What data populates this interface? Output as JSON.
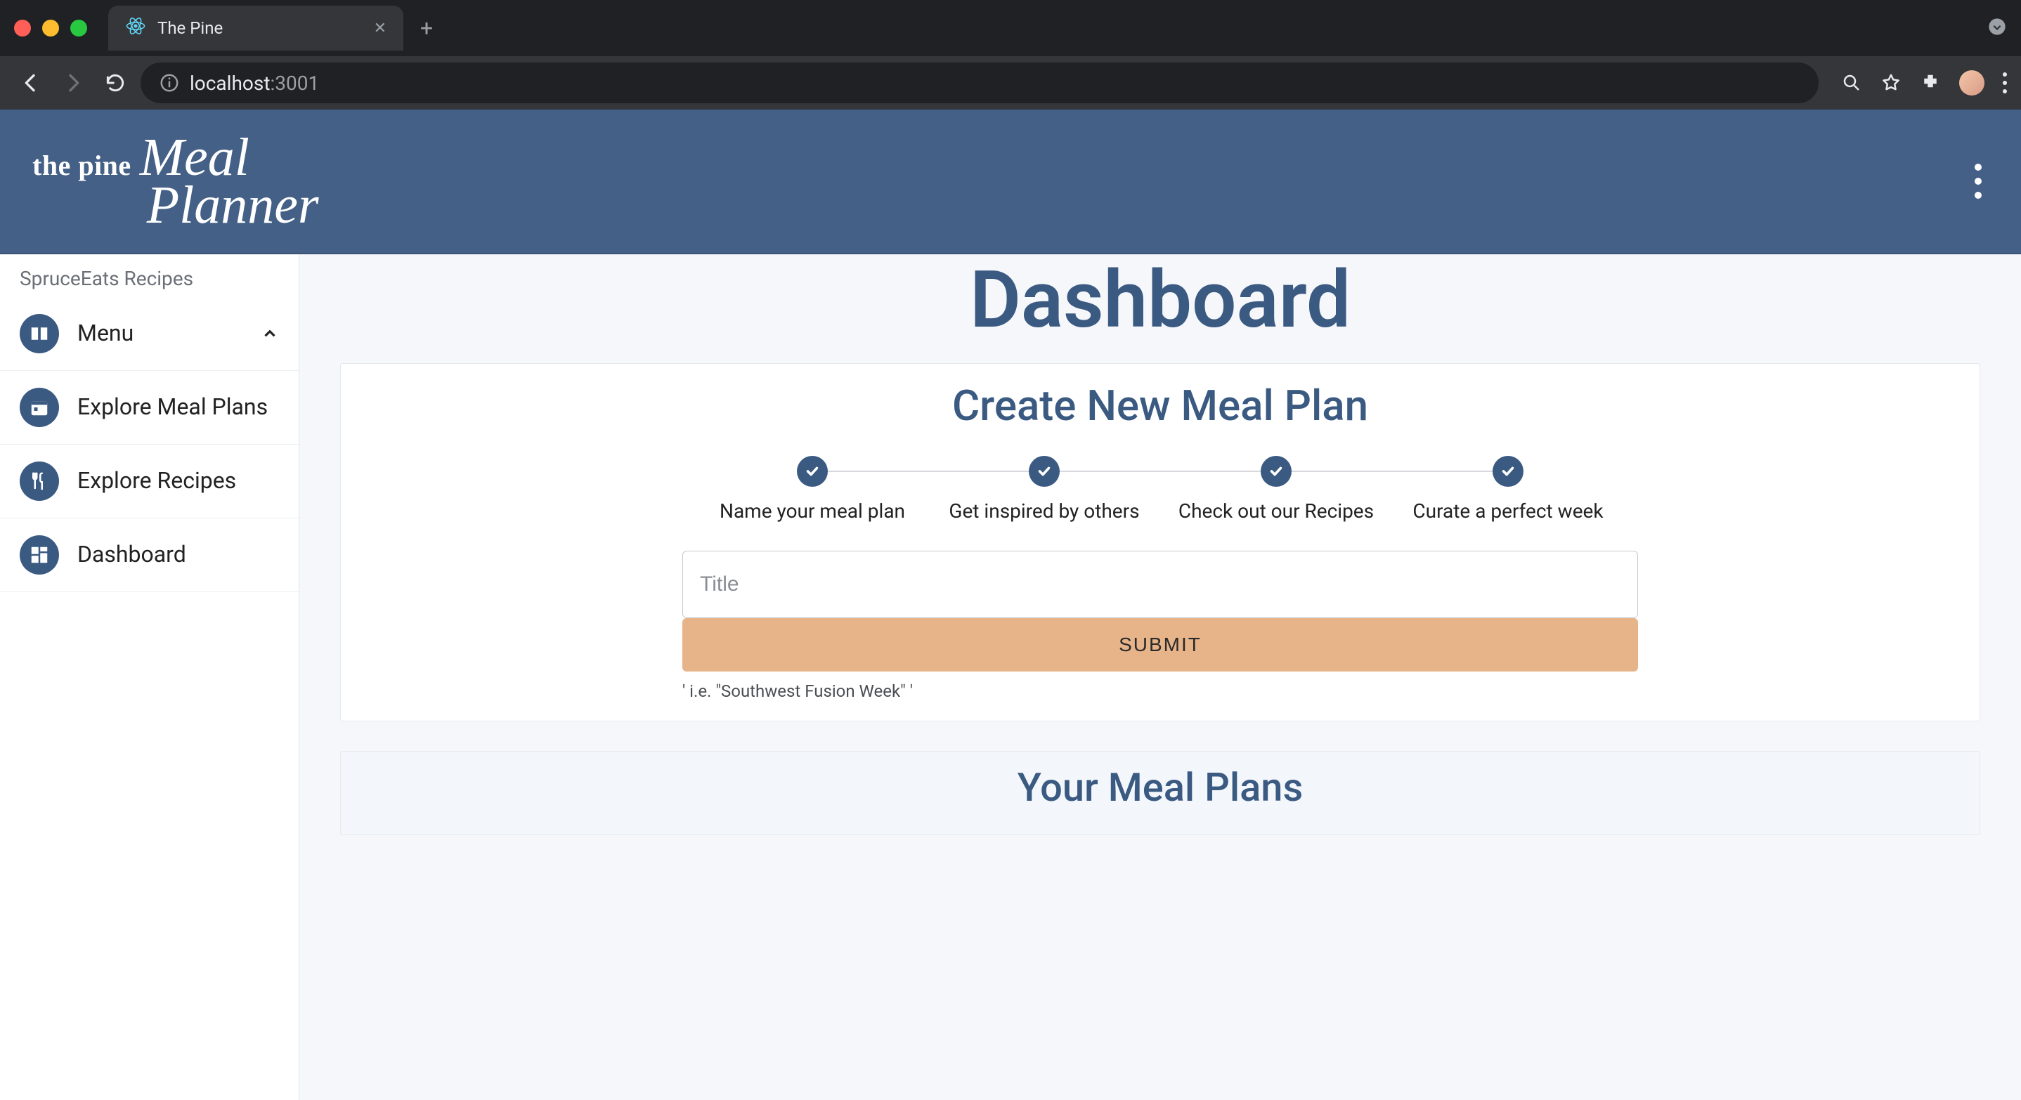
{
  "browser": {
    "tab_title": "The Pine",
    "url_host": "localhost",
    "url_port": ":3001"
  },
  "header": {
    "brand_prefix": "the pine",
    "brand_script_line1": "Meal",
    "brand_script_line2": "Planner"
  },
  "sidebar": {
    "eyebrow": "SpruceEats Recipes",
    "items": [
      {
        "label": "Menu",
        "expandable": true
      },
      {
        "label": "Explore Meal Plans"
      },
      {
        "label": "Explore Recipes"
      },
      {
        "label": "Dashboard"
      }
    ]
  },
  "main": {
    "title": "Dashboard",
    "create_section": {
      "heading": "Create New Meal Plan",
      "steps": [
        "Name your meal plan",
        "Get inspired by others",
        "Check out our Recipes",
        "Curate a perfect week"
      ],
      "title_placeholder": "Title",
      "submit_label": "SUBMIT",
      "helper_text": "' i.e. \"Southwest Fusion Week\" '"
    },
    "plans_section": {
      "heading": "Your Meal Plans"
    }
  }
}
